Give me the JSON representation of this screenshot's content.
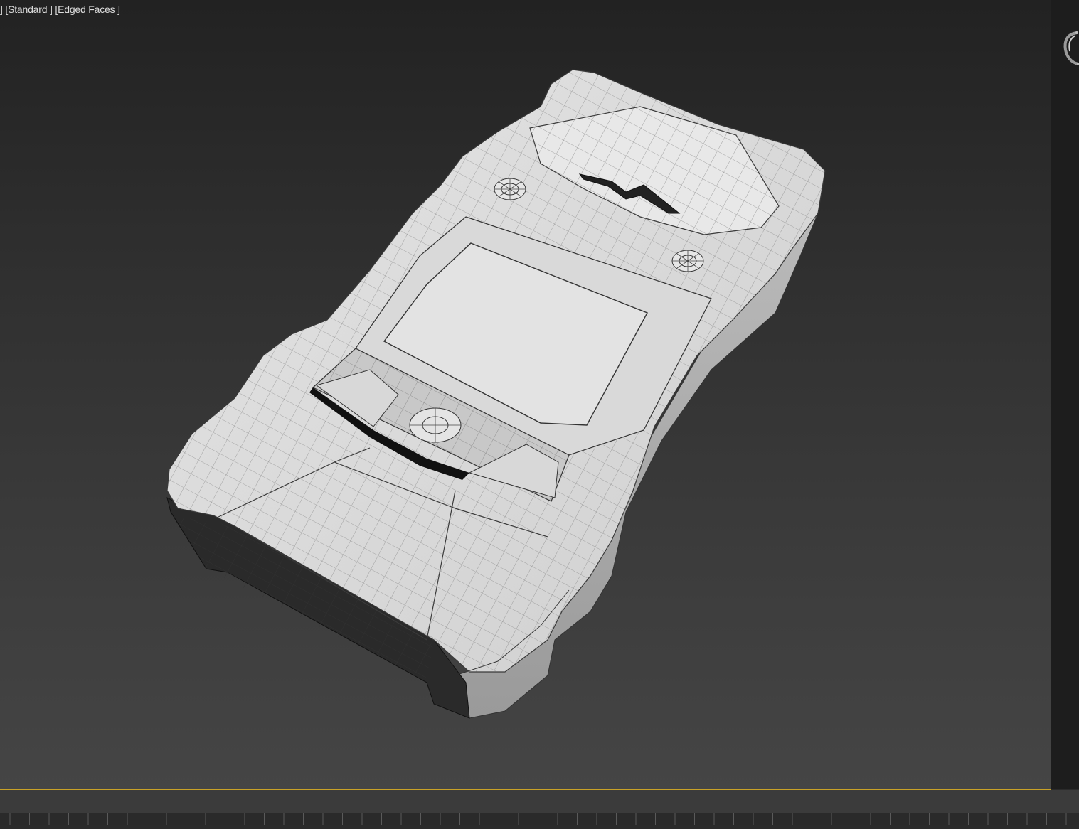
{
  "viewport": {
    "label_left": "]",
    "label_shading": "[Standard ]",
    "label_faces": "[Edged Faces ]"
  },
  "colors": {
    "viewport_border": "#c9a227",
    "mesh_fill": "#d6d6d6",
    "wire": "#4a4a4a",
    "background_top": "#222222",
    "background_bottom": "#454545"
  },
  "icons": {
    "viewcube": "viewcube-icon",
    "model": "mesh-model"
  }
}
